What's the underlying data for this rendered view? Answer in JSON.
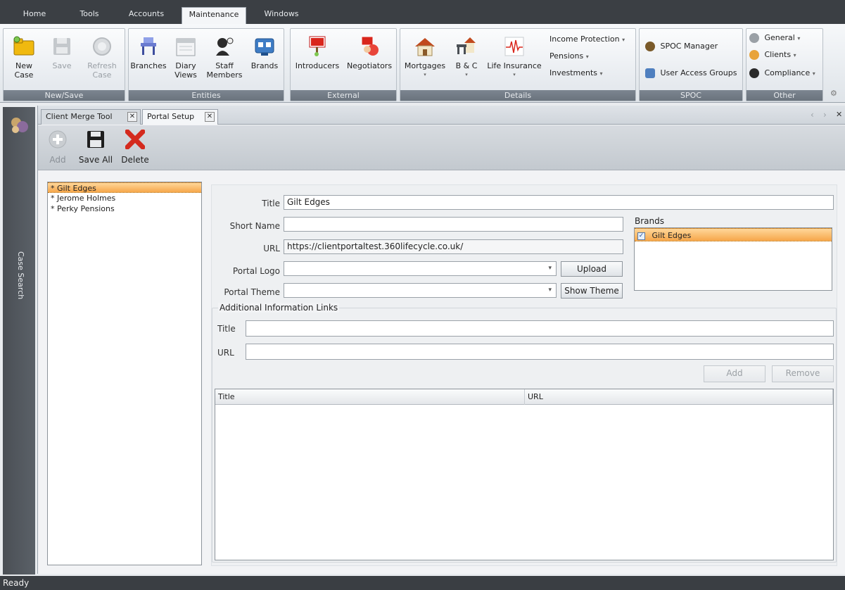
{
  "menu_tabs": [
    "Home",
    "Tools",
    "Accounts",
    "Maintenance",
    "Windows"
  ],
  "active_menu_tab": "Maintenance",
  "ribbon": {
    "groups": {
      "new_save": "New/Save",
      "entities": "Entities",
      "external": "External",
      "details": "Details",
      "spoc": "SPOC",
      "other": "Other"
    },
    "new_case": "New Case",
    "save": "Save",
    "refresh_case_1": "Refresh",
    "refresh_case_2": "Case",
    "branches": "Branches",
    "diary_views_1": "Diary",
    "diary_views_2": "Views",
    "staff_members_1": "Staff",
    "staff_members_2": "Members",
    "brands": "Brands",
    "introducers": "Introducers",
    "negotiators": "Negotiators",
    "mortgages": "Mortgages",
    "bc": "B & C",
    "life_insurance": "Life Insurance",
    "income_protection": "Income Protection",
    "pensions": "Pensions",
    "investments": "Investments",
    "spoc_manager": "SPOC Manager",
    "user_access_groups": "User Access Groups",
    "general": "General",
    "clients": "Clients",
    "compliance": "Compliance",
    "dropdown_glyph": "▾"
  },
  "side_panel": {
    "label": "Case Search"
  },
  "doc_tabs": [
    {
      "label": "Client Merge Tool",
      "close": "✕"
    },
    {
      "label": "Portal Setup",
      "close": "✕"
    }
  ],
  "tab_scroll": {
    "left": "‹",
    "right": "›",
    "close": "✕"
  },
  "toolbar": {
    "add": "Add",
    "save_all": "Save All",
    "delete": "Delete"
  },
  "portals": [
    "* Gilt Edges",
    "* Jerome Holmes",
    "* Perky Pensions"
  ],
  "selected_portal_index": 0,
  "form": {
    "title_label": "Title",
    "title_value": "Gilt Edges",
    "short_name_label": "Short Name",
    "short_name_value": "",
    "url_label": "URL",
    "url_value": "https://clientportaltest.360lifecycle.co.uk/",
    "portal_logo_label": "Portal Logo",
    "portal_logo_value": "",
    "portal_theme_label": "Portal Theme",
    "portal_theme_value": "",
    "upload_button": "Upload",
    "show_theme_button": "Show Theme"
  },
  "brands": {
    "label": "Brands",
    "items": [
      {
        "name": "Gilt Edges",
        "checked": true,
        "check_glyph": "✓"
      }
    ]
  },
  "additional_links": {
    "legend": "Additional Information Links",
    "title_label": "Title",
    "title_value": "",
    "url_label": "URL",
    "url_value": "",
    "add_button": "Add",
    "remove_button": "Remove",
    "columns": [
      "Title",
      "URL"
    ]
  },
  "status_text": "Ready",
  "colors": {
    "selection_orange": "#f6a64a",
    "dark_chrome": "#3b3f44",
    "delete_red": "#d42a1e",
    "group_caption": "#6a737d"
  }
}
